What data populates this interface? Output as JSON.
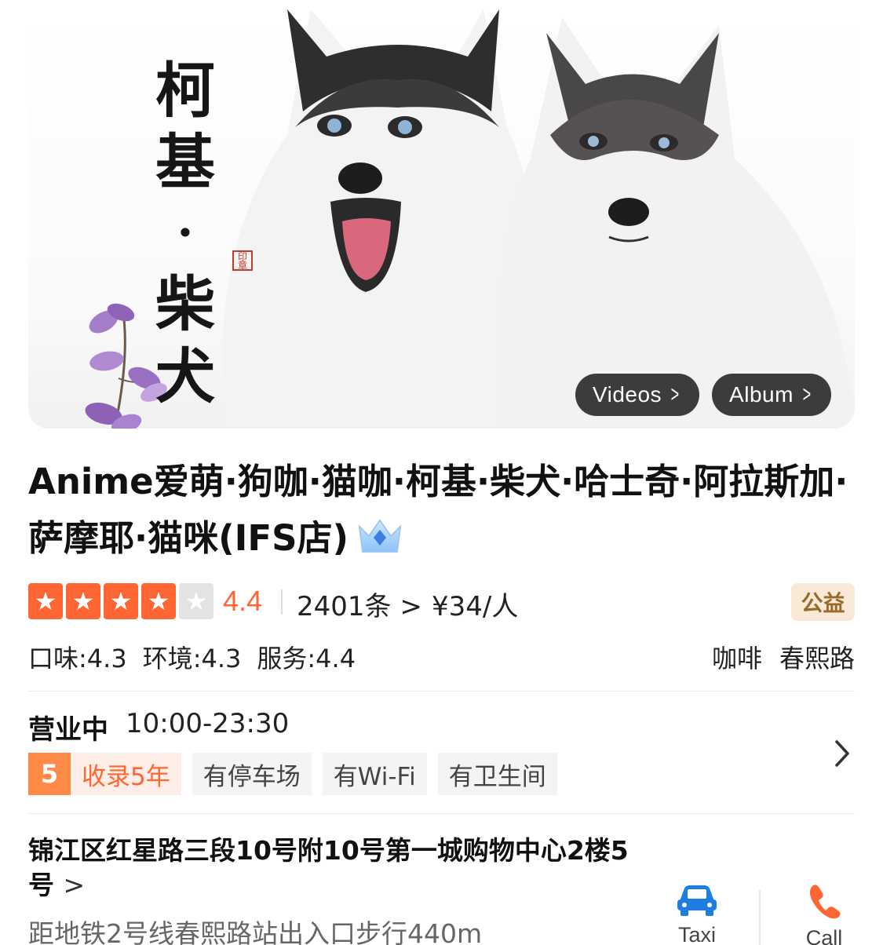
{
  "hero": {
    "calligraphy": [
      "柯",
      "基",
      "·",
      "柴",
      "犬"
    ],
    "videos_label": "Videos",
    "album_label": "Album"
  },
  "shop": {
    "name": "Anime爱萌·狗咖·猫咖·柯基·柴犬·哈士奇·阿拉斯加·萨摩耶·猫咪(IFS店)",
    "rating": "4.4",
    "stars_filled": 4,
    "stars_total": 5,
    "reviews": "2401条",
    "price": "¥34/人",
    "charity_badge": "公益"
  },
  "sub_scores": {
    "taste": "口味:4.3",
    "environment": "环境:4.3",
    "service": "服务:4.4"
  },
  "tags": {
    "category": "咖啡",
    "area": "春熙路"
  },
  "hours": {
    "status": "营业中",
    "time": "10:00-23:30"
  },
  "chips": {
    "years_num": "5",
    "years_label": "收录5年",
    "parking": "有停车场",
    "wifi": "有Wi-Fi",
    "restroom": "有卫生间"
  },
  "address": {
    "text": "锦江区红星路三段10号附10号第一城购物中心2楼5号",
    "metro": "距地铁2号线春熙路站出入口步行440m"
  },
  "actions": {
    "taxi": "Taxi",
    "call": "Call"
  },
  "colors": {
    "accent": "#ff6633",
    "taxi_icon": "#1f7ce0",
    "call_icon": "#ff6633",
    "charity_bg": "#f8ead7",
    "charity_text": "#9a6a2c"
  },
  "icons": {
    "crown": "crown-icon",
    "taxi": "car-icon",
    "call": "phone-icon",
    "chevron": "chevron-right-icon"
  }
}
